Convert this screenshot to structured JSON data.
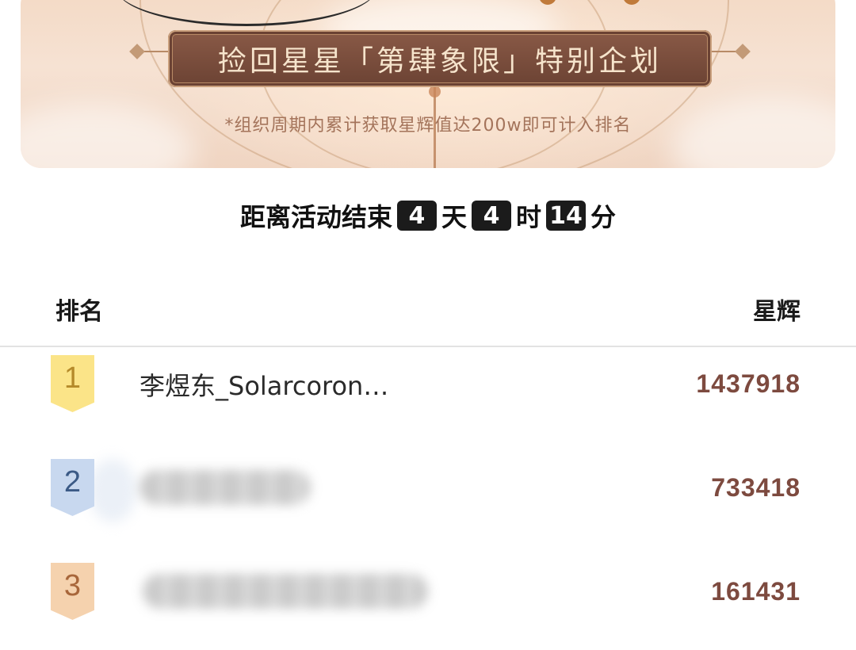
{
  "banner": {
    "title": "捡回星星「第肆象限」特别企划",
    "subtitle": "*组织周期内累计获取星辉值达200w即可计入排名"
  },
  "countdown": {
    "prefix": "距离活动结束",
    "days": "4",
    "days_unit": "天",
    "hours": "4",
    "hours_unit": "时",
    "minutes": "14",
    "minutes_unit": "分"
  },
  "table": {
    "headers": {
      "rank": "排名",
      "score": "星辉"
    },
    "rows": [
      {
        "rank": "1",
        "name": "李煜东_Solarcoron…",
        "score": "1437918",
        "name_blurred": false
      },
      {
        "rank": "2",
        "name": "",
        "score": "733418",
        "name_blurred": true
      },
      {
        "rank": "3",
        "name": "",
        "score": "161431",
        "name_blurred": true
      }
    ]
  },
  "colors": {
    "banner_bg": "#f3d9c4",
    "title_plate": "#7a4d3c",
    "score_text": "#7d4a3f",
    "badge_gold": "#fbe488",
    "badge_silver": "#c8d8ef",
    "badge_bronze": "#f5d2ae"
  }
}
